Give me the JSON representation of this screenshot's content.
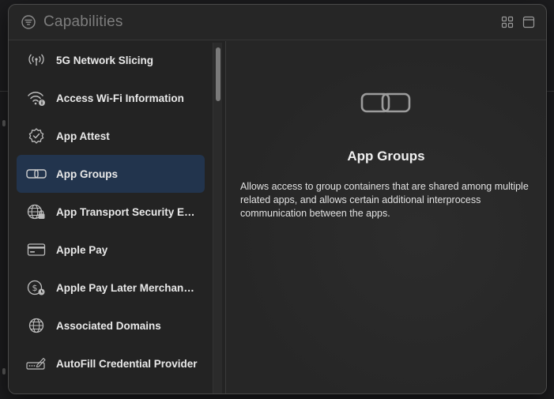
{
  "window": {
    "title": "Capabilities",
    "title_icon": "filter-circle-icon",
    "toolbar": {
      "grid_icon": "grid-view-icon",
      "panel_icon": "panel-view-icon"
    }
  },
  "sidebar": {
    "items": [
      {
        "label": "5G Network Slicing",
        "icon": "antenna-icon",
        "selected": false
      },
      {
        "label": "Access Wi-Fi Information",
        "icon": "wifi-info-icon",
        "selected": false
      },
      {
        "label": "App Attest",
        "icon": "checkmark-seal-icon",
        "selected": false
      },
      {
        "label": "App Groups",
        "icon": "link-icon",
        "selected": true
      },
      {
        "label": "App Transport Security Exce...",
        "icon": "globe-lock-icon",
        "selected": false
      },
      {
        "label": "Apple Pay",
        "icon": "credit-card-icon",
        "selected": false
      },
      {
        "label": "Apple Pay Later Merchandisi...",
        "icon": "dollar-clock-icon",
        "selected": false
      },
      {
        "label": "Associated Domains",
        "icon": "globe-icon",
        "selected": false
      },
      {
        "label": "AutoFill Credential Provider",
        "icon": "autofill-field-icon",
        "selected": false
      }
    ]
  },
  "detail": {
    "title": "App Groups",
    "description": "Allows access to group containers that are shared among multiple related apps, and allows certain additional interprocess communication between the apps."
  },
  "colors": {
    "selection": "#22344d",
    "background": "#262626"
  }
}
